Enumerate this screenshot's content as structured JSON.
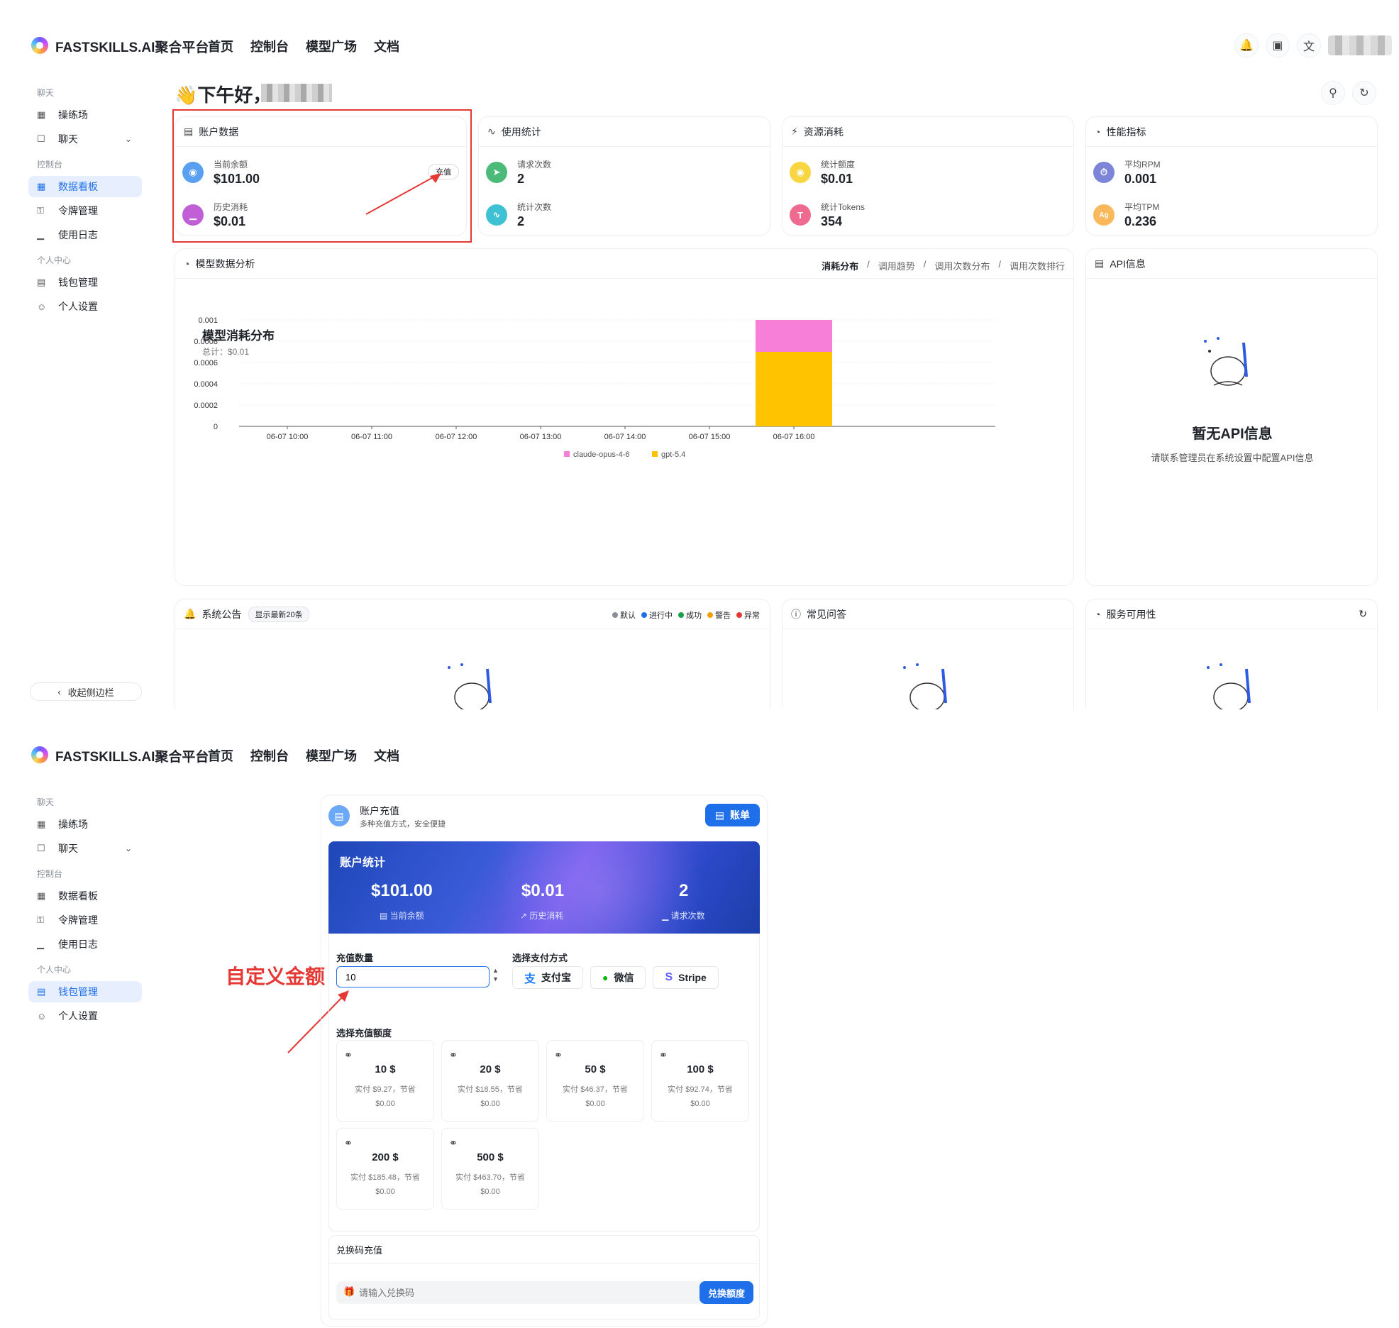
{
  "brand": "FASTSKILLS.AI聚合平台",
  "nav": [
    "首页",
    "控制台",
    "模型广场",
    "文档"
  ],
  "sidebar": {
    "sections": {
      "chat": "聊天",
      "console": "控制台",
      "personal": "个人中心"
    },
    "items": {
      "playground": "操练场",
      "chat": "聊天",
      "dashboard": "数据看板",
      "tokens": "令牌管理",
      "logs": "使用日志",
      "wallet": "钱包管理",
      "settings": "个人设置"
    },
    "collapse": "收起侧边栏"
  },
  "greeting": "👋下午好，",
  "account_card": {
    "title": "账户数据",
    "balance_label": "当前余额",
    "balance": "$101.00",
    "spent_label": "历史消耗",
    "spent": "$0.01",
    "recharge_btn": "充值"
  },
  "usage_card": {
    "title": "使用统计",
    "requests_label": "请求次数",
    "requests": "2",
    "stat_label": "统计次数",
    "stat": "2"
  },
  "resource_card": {
    "title": "资源消耗",
    "quota_label": "统计额度",
    "quota": "$0.01",
    "tokens_label": "统计Tokens",
    "tokens": "354"
  },
  "perf_card": {
    "title": "性能指标",
    "rpm_label": "平均RPM",
    "rpm": "0.001",
    "tpm_label": "平均TPM",
    "tpm": "0.236",
    "tpm_icon": "Ag"
  },
  "analysis_card": {
    "title": "模型数据分析",
    "tabs": [
      "消耗分布",
      "调用趋势",
      "调用次数分布",
      "调用次数排行"
    ]
  },
  "chart_data": {
    "type": "bar",
    "title": "模型消耗分布",
    "subtitle": "总计：$0.01",
    "categories": [
      "06-07 10:00",
      "06-07 11:00",
      "06-07 12:00",
      "06-07 13:00",
      "06-07 14:00",
      "06-07 15:00",
      "06-07 16:00"
    ],
    "stacked": true,
    "series": [
      {
        "name": "gpt-5.4",
        "color": "#ffc300",
        "values": [
          0,
          0,
          0,
          0,
          0,
          0,
          0.0007
        ]
      },
      {
        "name": "claude-opus-4-6",
        "color": "#f77fd8",
        "values": [
          0,
          0,
          0,
          0,
          0,
          0,
          0.0003
        ]
      }
    ],
    "yticks": [
      "0",
      "0.0002",
      "0.0004",
      "0.0006",
      "0.0008",
      "0.001"
    ],
    "ylim": [
      0,
      0.001
    ],
    "legend": "bottom-center"
  },
  "api_card": {
    "title": "API信息",
    "empty_title": "暂无API信息",
    "empty_desc": "请联系管理员在系统设置中配置API信息"
  },
  "announce_card": {
    "title": "系统公告",
    "badge": "显示最新20条",
    "legend": [
      {
        "label": "默认",
        "color": "#8a8f98"
      },
      {
        "label": "进行中",
        "color": "#1f6feb"
      },
      {
        "label": "成功",
        "color": "#16a34a"
      },
      {
        "label": "警告",
        "color": "#f59e0b"
      },
      {
        "label": "异常",
        "color": "#e53935"
      }
    ]
  },
  "faq_card": {
    "title": "常见问答"
  },
  "service_card": {
    "title": "服务可用性"
  },
  "recharge": {
    "title": "账户充值",
    "subtitle": "多种充值方式，安全便捷",
    "bill_btn": "账单",
    "stats_title": "账户统计",
    "balance": "$101.00",
    "balance_label": "当前余额",
    "spent": "$0.01",
    "spent_label": "历史消耗",
    "requests": "2",
    "requests_label": "请求次数",
    "amount_label": "充值数量",
    "amount_value": "10",
    "pay_label": "选择支付方式",
    "pay_methods": [
      "支付宝",
      "微信",
      "Stripe"
    ],
    "preset_label": "选择充值额度",
    "presets": [
      {
        "amount": "10 $",
        "pay": "实付 $9.27，节省",
        "save": "$0.00"
      },
      {
        "amount": "20 $",
        "pay": "实付 $18.55，节省",
        "save": "$0.00"
      },
      {
        "amount": "50 $",
        "pay": "实付 $46.37，节省",
        "save": "$0.00"
      },
      {
        "amount": "100 $",
        "pay": "实付 $92.74，节省",
        "save": "$0.00"
      },
      {
        "amount": "200 $",
        "pay": "实付 $185.48，节省",
        "save": "$0.00"
      },
      {
        "amount": "500 $",
        "pay": "实付 $463.70，节省",
        "save": "$0.00"
      }
    ],
    "redeem_title": "兑换码充值",
    "redeem_placeholder": "请输入兑换码",
    "redeem_btn": "兑换额度"
  },
  "annotation": "自定义金额"
}
